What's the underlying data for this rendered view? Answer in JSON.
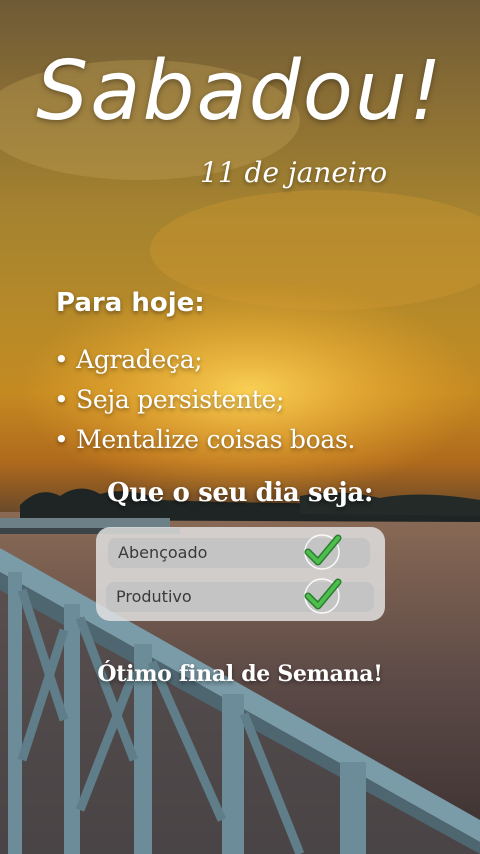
{
  "title": "Sabadou!",
  "date": "11 de janeiro",
  "today": {
    "heading": "Para hoje:",
    "items": [
      "Agradeça;",
      "Seja persistente;",
      "Mentalize coisas boas."
    ]
  },
  "wish": {
    "question": "Que o seu dia seja:",
    "options": [
      {
        "label": "Abençoado",
        "checked": true
      },
      {
        "label": "Produtivo",
        "checked": true
      }
    ]
  },
  "closing": "Ótimo final de Semana!",
  "colors": {
    "check_green": "#3cae3c",
    "panel": "#e1e1e1"
  }
}
